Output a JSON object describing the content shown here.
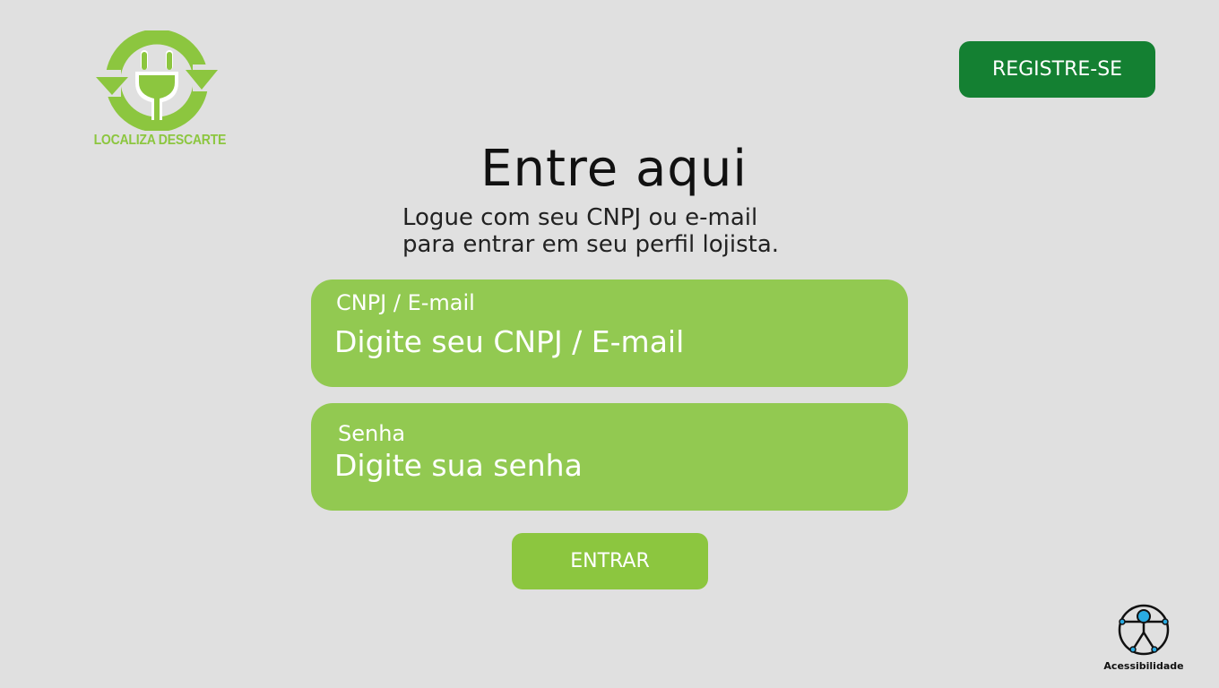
{
  "brand": {
    "name": "LOCALIZA DESCARTE",
    "logo_icon": "plug-recycle-icon",
    "color": "#8cc63f"
  },
  "header": {
    "register_label": "REGISTRE-SE",
    "register_color": "#148032"
  },
  "login": {
    "title": "Entre aqui",
    "subtitle_line1": "Logue com seu CNPJ ou e-mail",
    "subtitle_line2": "para entrar em seu perfil lojista.",
    "field_color": "#92c951",
    "id_field": {
      "label": "CNPJ  / E-mail",
      "placeholder": "Digite seu CNPJ / E-mail",
      "value": ""
    },
    "password_field": {
      "label": "Senha",
      "placeholder": "Digite sua senha",
      "value": ""
    },
    "submit_label": "ENTRAR",
    "submit_color": "#8cc63f"
  },
  "accessibility": {
    "label": "Acessibilidade",
    "icon": "accessibility-icon",
    "accent": "#29abe2"
  }
}
